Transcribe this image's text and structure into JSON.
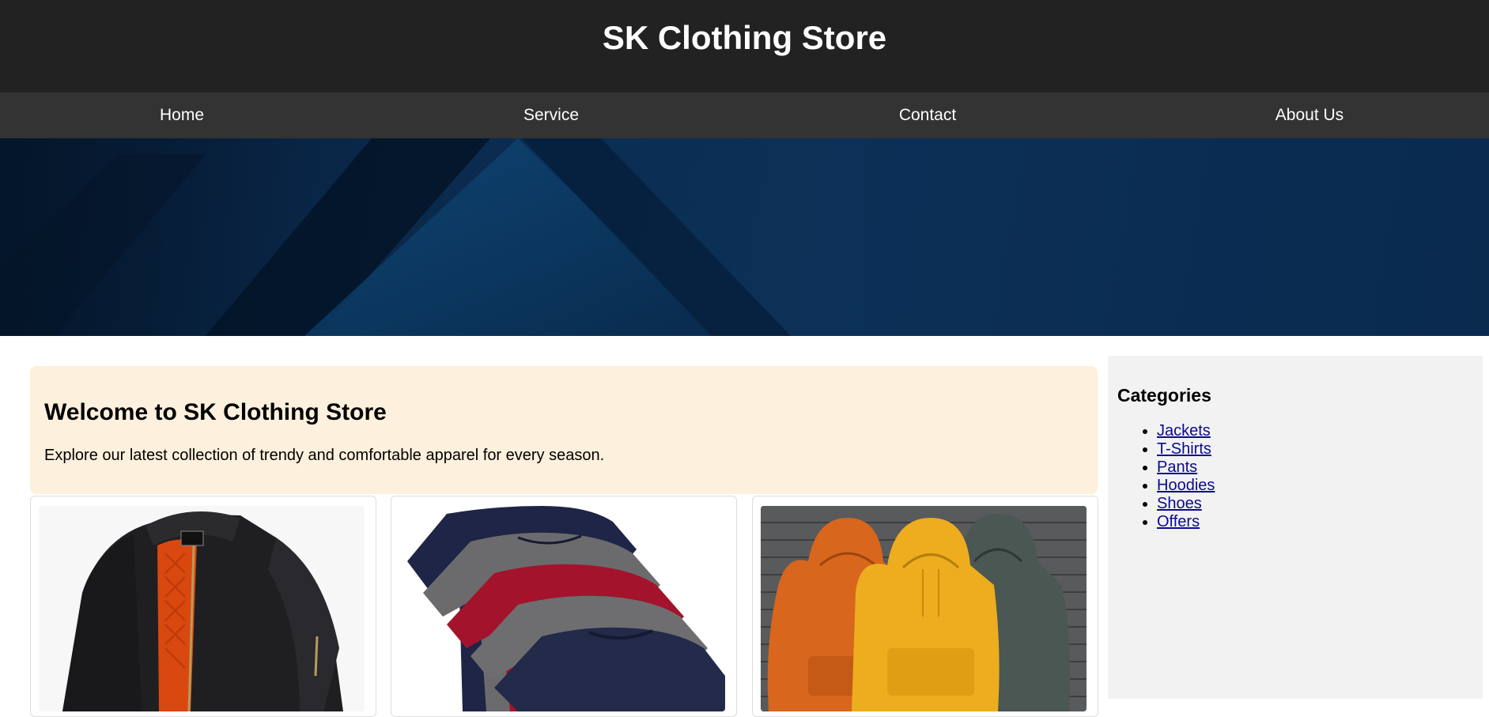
{
  "store_title": "SK Clothing Store",
  "nav": {
    "items": [
      {
        "label": "Home"
      },
      {
        "label": "Service"
      },
      {
        "label": "Contact"
      },
      {
        "label": "About Us"
      }
    ]
  },
  "welcome": {
    "heading": "Welcome to SK Clothing Store",
    "text": "Explore our latest collection of trendy and comfortable apparel for every season."
  },
  "products": [
    {
      "image": "black-bomber-jacket"
    },
    {
      "image": "stack-of-tshirts"
    },
    {
      "image": "three-hoodies"
    }
  ],
  "sidebar": {
    "heading": "Categories",
    "categories": [
      {
        "label": "Jackets"
      },
      {
        "label": "T-Shirts"
      },
      {
        "label": "Pants"
      },
      {
        "label": "Hoodies"
      },
      {
        "label": "Shoes"
      },
      {
        "label": "Offers"
      }
    ]
  },
  "colors": {
    "header_bg": "#222222",
    "nav_bg": "#333333",
    "welcome_bg": "#fdf0dc",
    "sidebar_bg": "#f2f2f2",
    "link": "#0b0b8f"
  }
}
